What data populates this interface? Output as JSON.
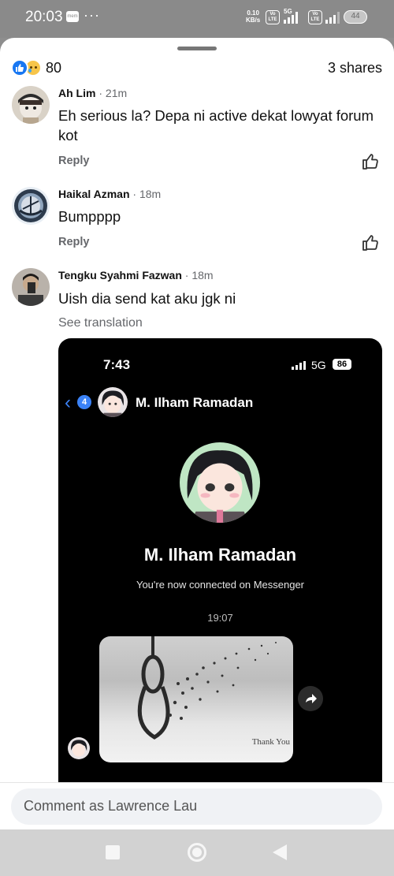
{
  "status_bar": {
    "time": "20:03",
    "app_badge": "mem",
    "overflow": "···",
    "net_rate_value": "0.10",
    "net_rate_unit": "KB/s",
    "volte1": "Vo LTE",
    "network1": "5G",
    "volte2": "Vo LTE",
    "battery": "44"
  },
  "reactions": {
    "count": "80",
    "icons": [
      "like-icon",
      "sad-icon"
    ],
    "shares": "3 shares"
  },
  "comments": [
    {
      "author": "Ah Lim",
      "time": "21m",
      "text": "Eh serious la? Depa ni active dekat lowyat forum kot",
      "reply": "Reply"
    },
    {
      "author": "Haikal Azman",
      "time": "18m",
      "text": "Bumpppp",
      "reply": "Reply"
    },
    {
      "author": "Tengku Syahmi Fazwan",
      "time": "18m",
      "text": "Uish dia send kat aku jgk ni",
      "see_translation": "See translation"
    }
  ],
  "attached_screenshot": {
    "time": "7:43",
    "network": "5G",
    "battery": "86",
    "unread_count": "4",
    "contact_name": "M. Ilham Ramadan",
    "profile_name": "M. Ilham Ramadan",
    "connected_text": "You're now connected on Messenger",
    "timestamp": "19:07",
    "photo_caption": "Thank You"
  },
  "composer": {
    "placeholder": "Comment as Lawrence Lau"
  },
  "colors": {
    "accent": "#1877f2",
    "secondary_text": "#65676b",
    "messenger_blue": "#3b82f6"
  }
}
